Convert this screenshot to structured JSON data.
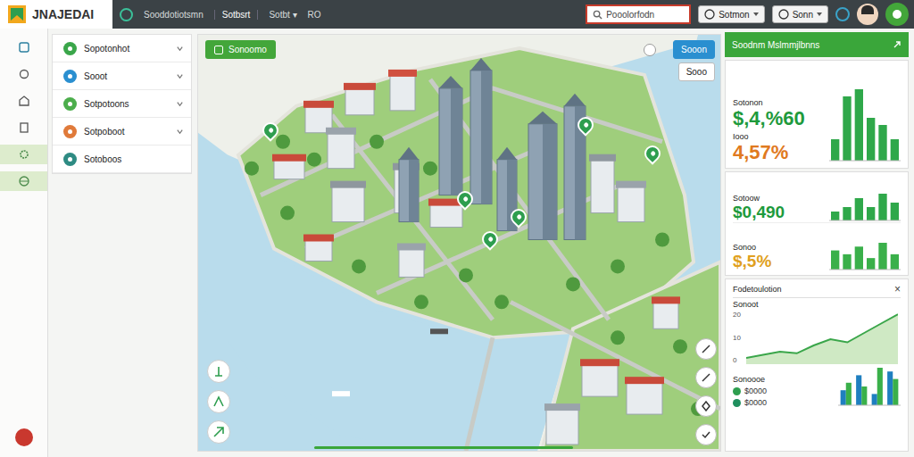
{
  "logo": {
    "text": "JNAJEDAI"
  },
  "topbar": {
    "nav": [
      {
        "label": "Sooddotiotsmn",
        "selected": false
      },
      {
        "label": "Sotbsrt",
        "selected": true
      },
      {
        "label": "Sotbt ▾",
        "selected": false
      },
      {
        "label": "RO",
        "selected": false
      }
    ],
    "search": {
      "placeholder": "Pooolorfodn"
    },
    "buttons": [
      "Sotmon",
      "Sonn"
    ]
  },
  "rail": [
    {
      "kind": "grid",
      "selected": false
    },
    {
      "kind": "pin",
      "selected": false
    },
    {
      "kind": "building",
      "selected": false
    },
    {
      "kind": "copy",
      "selected": false
    },
    {
      "kind": "gear",
      "selected": true
    },
    {
      "kind": "globe",
      "selected": true
    }
  ],
  "sidebar": {
    "items": [
      {
        "label": "Sopotonhot",
        "color": "#3aa64a",
        "expandable": true,
        "expanded": false
      },
      {
        "label": "Sooot",
        "color": "#2a8fd0",
        "expandable": true,
        "expanded": false
      },
      {
        "label": "Sotpotoons",
        "color": "#4cae4c",
        "expandable": true,
        "expanded": false
      },
      {
        "label": "Sotpoboot",
        "color": "#e07a3a",
        "expandable": true,
        "expanded": false
      },
      {
        "label": "Sotoboos",
        "color": "#2e8b83",
        "expandable": false,
        "expanded": false
      }
    ]
  },
  "map": {
    "button": "Sonoomo",
    "top_buttons": [
      {
        "label": "Sooon",
        "selected": true
      },
      {
        "label": "Sooo",
        "selected": false
      }
    ]
  },
  "panel": {
    "title": "Soodnm Mslmmjlbnns",
    "card1": {
      "metrics": [
        {
          "label": "Sotonon",
          "value": "$,4,%60",
          "color": "#1e9a3c"
        },
        {
          "label": "Iooo",
          "value": "4,57%",
          "color": "#e07a1f"
        }
      ],
      "series": [
        {
          "name": "a",
          "color": "#2fa84a",
          "values": [
            3,
            9,
            10,
            6,
            5,
            3
          ]
        }
      ]
    },
    "card2": {
      "rows": [
        {
          "label": "Sotoow",
          "value": "$0,490",
          "color": "#1e9a3c",
          "series": [
            {
              "name": "a",
              "color": "#2fa84a",
              "values": [
                2,
                3,
                5,
                3,
                6,
                4
              ]
            }
          ]
        },
        {
          "label": "Sonoo",
          "value": "$,5%",
          "color": "#e0a020",
          "series": [
            {
              "name": "a",
              "color": "#3ab04a",
              "values": [
                5,
                4,
                6,
                3,
                7,
                4
              ]
            }
          ]
        }
      ]
    },
    "card3": {
      "title": "Fodetoulotion",
      "close": "×",
      "line_label": "Sonoot",
      "ticks": [
        "20",
        "10",
        "0"
      ],
      "line": {
        "name": "a",
        "color": "#3aa64a",
        "values": [
          2,
          3,
          4,
          3.5,
          6,
          8,
          7,
          10,
          13,
          16
        ]
      },
      "legend_title": "Sonoooe",
      "legend": [
        {
          "label": "$0000",
          "color": "#2e9e4f"
        },
        {
          "label": "$0000",
          "color": "#1f8f5e"
        }
      ],
      "series": [
        {
          "name": "a",
          "color": "#1f7fc0",
          "values": [
            4,
            8,
            3,
            9
          ]
        },
        {
          "name": "b",
          "color": "#3ab04a",
          "values": [
            6,
            5,
            10,
            7
          ]
        }
      ]
    }
  }
}
